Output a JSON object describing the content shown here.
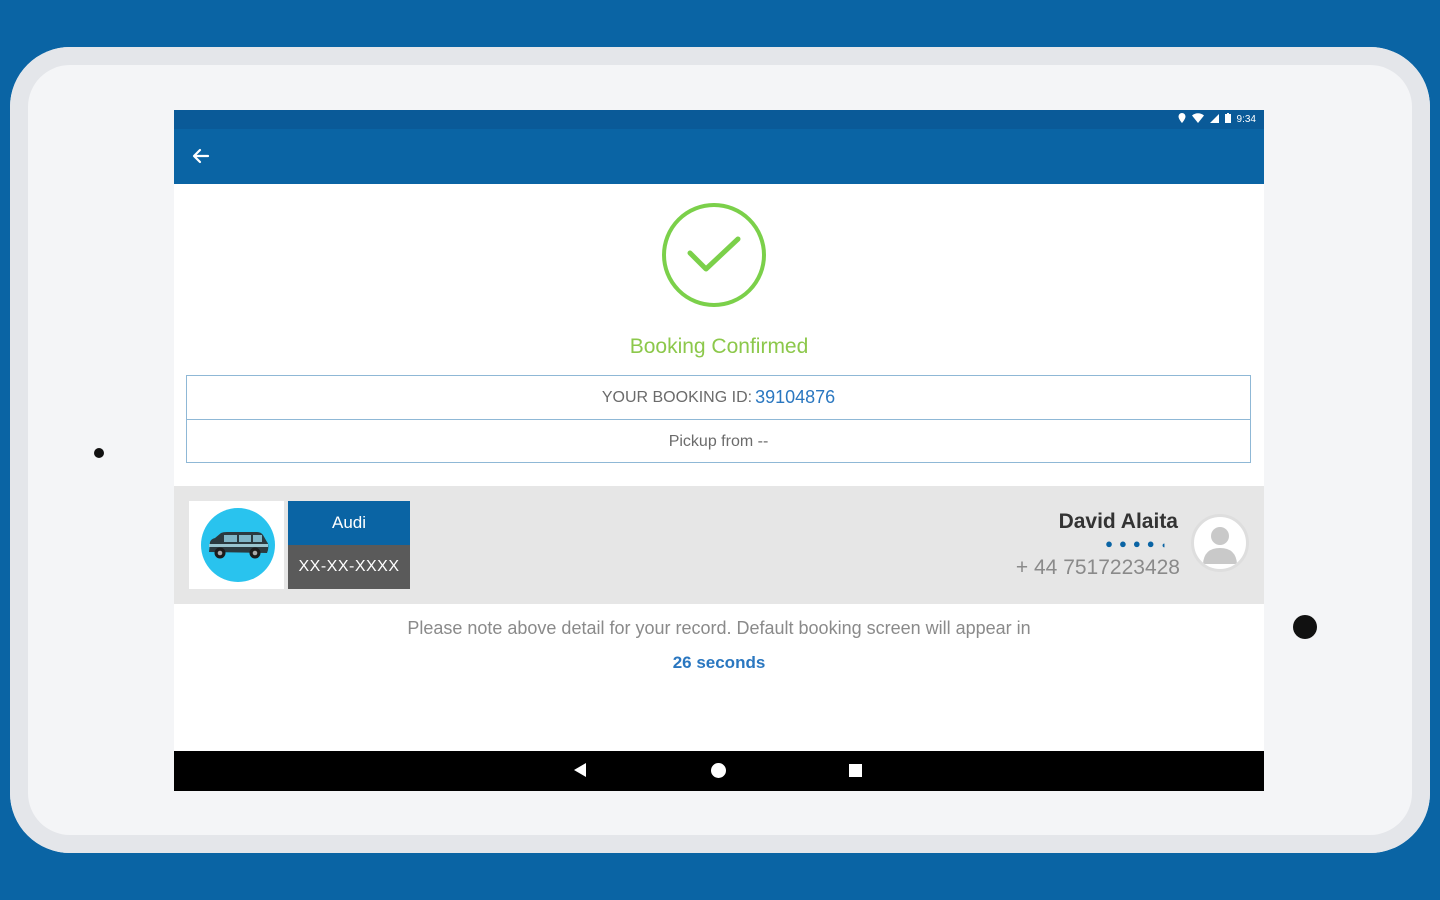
{
  "status_bar": {
    "time": "9:34"
  },
  "confirmation": {
    "title": "Booking Confirmed"
  },
  "booking": {
    "id_label": "YOUR BOOKING ID:",
    "id_value": "39104876",
    "pickup_label": "Pickup from --"
  },
  "vehicle": {
    "make": "Audi",
    "plate": "XX-XX-XXXX"
  },
  "driver": {
    "name": "David Alaita",
    "phone": "+ 44 7517223428",
    "rating_stars": 4.5
  },
  "notice": {
    "message": "Please note above detail for your record. Default booking screen will appear in",
    "countdown": "26 seconds"
  },
  "colors": {
    "brand": "#0a64a4",
    "success": "#7bd04a",
    "link": "#2a77c0",
    "avatar_bg": "#29c3ee"
  },
  "icons": {
    "back": "arrow-left-icon",
    "check": "check-circle-icon",
    "car": "car-icon",
    "person": "person-icon"
  }
}
